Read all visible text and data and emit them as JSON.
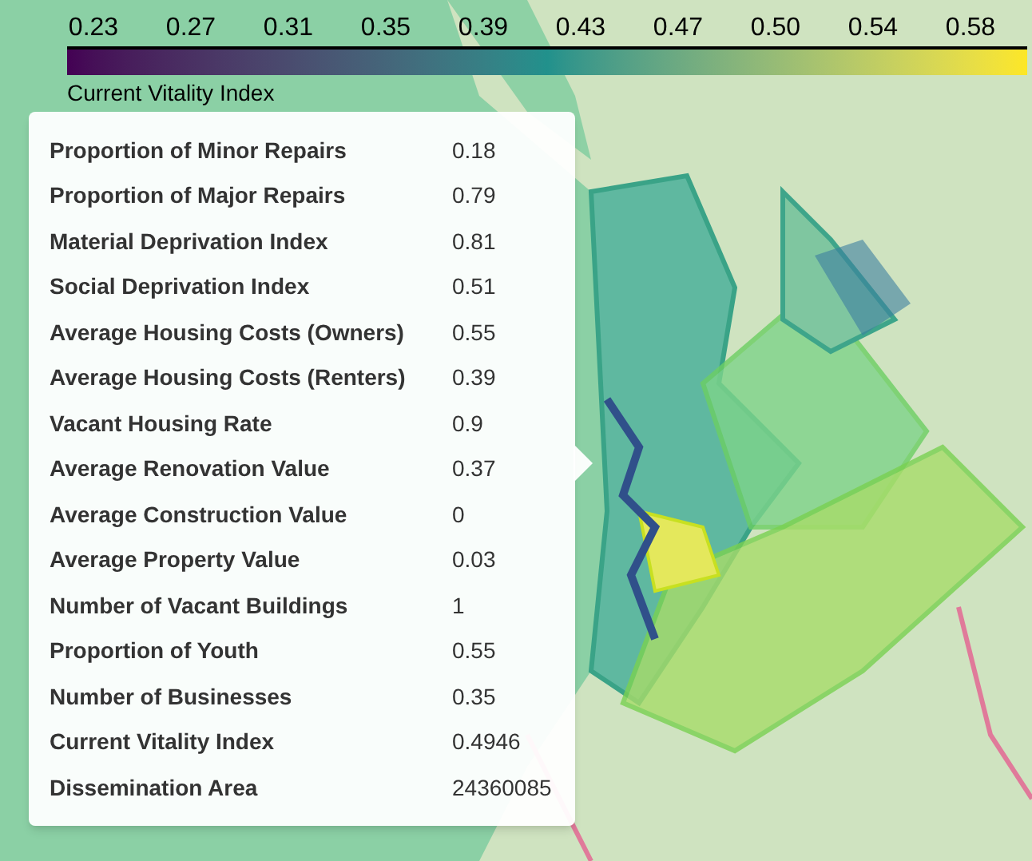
{
  "colorbar": {
    "ticks": [
      "0.23",
      "0.27",
      "0.31",
      "0.35",
      "0.39",
      "0.43",
      "0.47",
      "0.50",
      "0.54",
      "0.58"
    ],
    "title": "Current Vitality Index"
  },
  "tooltip": {
    "rows": [
      {
        "label": "Proportion of Minor Repairs",
        "value": "0.18"
      },
      {
        "label": "Proportion of Major Repairs",
        "value": "0.79"
      },
      {
        "label": "Material Deprivation Index",
        "value": "0.81"
      },
      {
        "label": "Social Deprivation Index",
        "value": "0.51"
      },
      {
        "label": "Average Housing Costs (Owners)",
        "value": "0.55"
      },
      {
        "label": "Average Housing Costs (Renters)",
        "value": "0.39"
      },
      {
        "label": "Vacant Housing Rate",
        "value": "0.9"
      },
      {
        "label": "Average Renovation Value",
        "value": "0.37"
      },
      {
        "label": "Average Construction Value",
        "value": "0"
      },
      {
        "label": "Average Property Value",
        "value": "0.03"
      },
      {
        "label": "Number of Vacant Buildings",
        "value": "1"
      },
      {
        "label": "Proportion of Youth",
        "value": "0.55"
      },
      {
        "label": "Number of Businesses",
        "value": "0.35"
      },
      {
        "label": "Current Vitality Index",
        "value": "0.4946"
      },
      {
        "label": "Dissemination Area",
        "value": "24360085"
      }
    ]
  }
}
